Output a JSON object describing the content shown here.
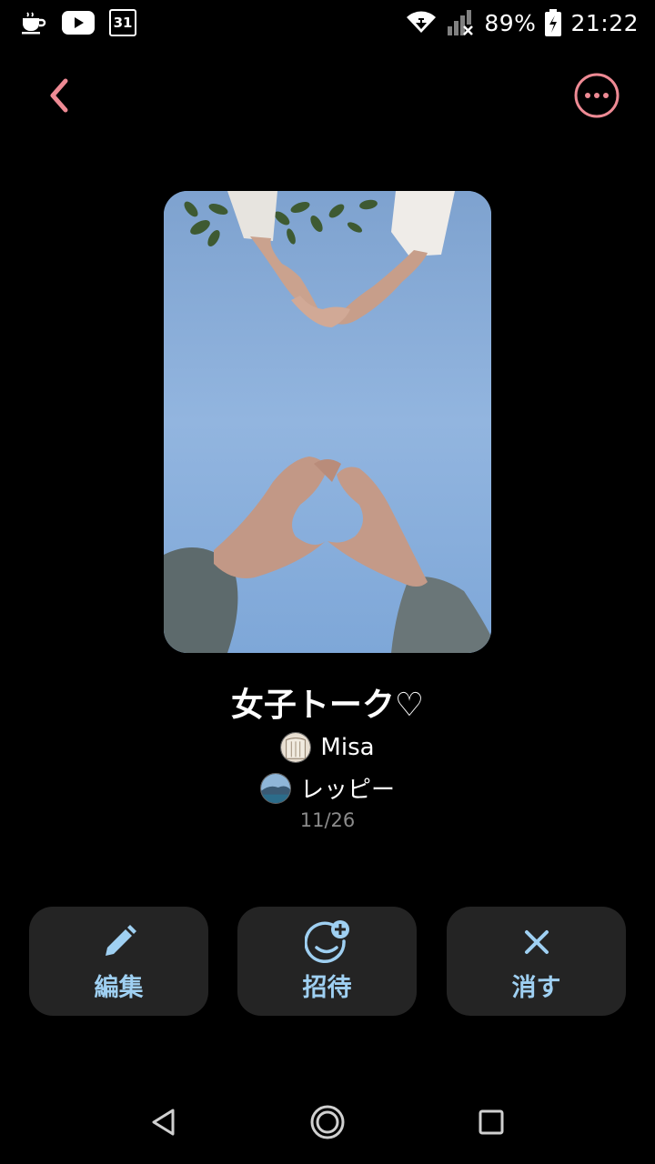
{
  "status_bar": {
    "battery": "89%",
    "time": "21:22",
    "calendar_day": "31",
    "icons": [
      "coffee-icon",
      "youtube-icon",
      "calendar-icon",
      "wifi-icon",
      "signal-icon",
      "battery-charging-icon"
    ]
  },
  "app_bar": {
    "back_icon": "chevron-left-icon",
    "more_icon": "more-horizontal-icon",
    "accent_color": "#ee8a94"
  },
  "room": {
    "title": "女子トーク♡",
    "members": [
      {
        "name": "Misa",
        "avatar": "avatar-misa"
      },
      {
        "name": "レッピー",
        "avatar": "avatar-leppy"
      }
    ],
    "date": "11/26"
  },
  "actions": {
    "edit": {
      "label": "編集",
      "icon": "pencil-icon"
    },
    "invite": {
      "label": "招待",
      "icon": "add-friend-icon"
    },
    "delete": {
      "label": "消す",
      "icon": "close-icon"
    },
    "label_color": "#9fd0f2"
  },
  "nav_bar": {
    "icons": [
      "nav-back-icon",
      "nav-home-icon",
      "nav-recent-icon"
    ]
  }
}
